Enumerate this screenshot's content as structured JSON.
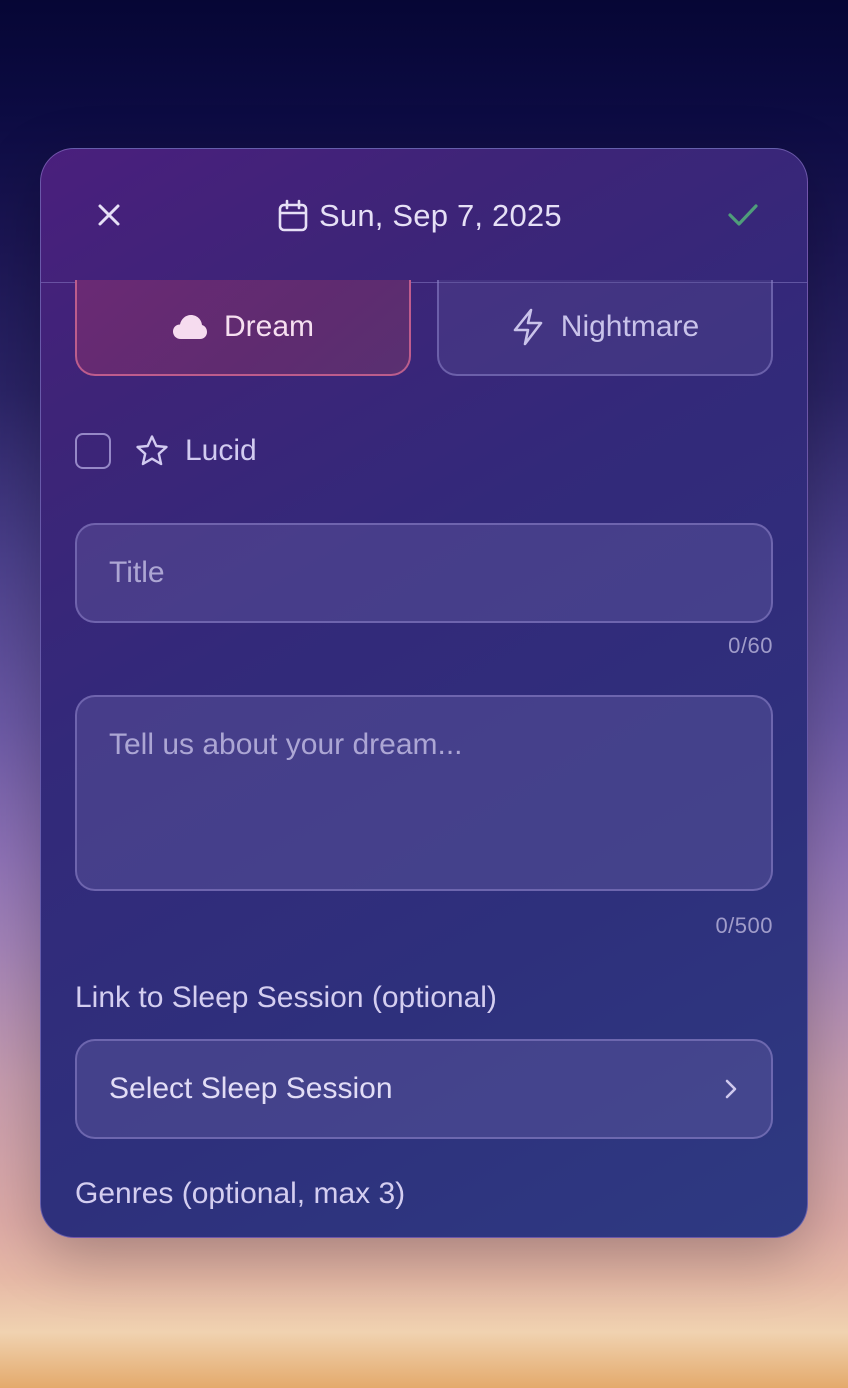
{
  "header": {
    "date": "Sun, Sep 7, 2025",
    "close_icon": "close-icon",
    "calendar_icon": "calendar-icon",
    "confirm_icon": "check-icon"
  },
  "type_toggle": {
    "dream_label": "Dream",
    "dream_icon": "cloud-icon",
    "nightmare_label": "Nightmare",
    "nightmare_icon": "lightning-icon",
    "selected": "Dream"
  },
  "lucid": {
    "label": "Lucid",
    "checked": false,
    "icon": "star-icon"
  },
  "title": {
    "placeholder": "Title",
    "value": "",
    "counter": "0/60"
  },
  "description": {
    "placeholder": "Tell us about your dream...",
    "value": "",
    "counter": "0/500"
  },
  "sleep_session": {
    "label": "Link to Sleep Session (optional)",
    "select_label": "Select Sleep Session",
    "icon": "chevron-right-icon"
  },
  "genres": {
    "label": "Genres (optional, max 3)"
  },
  "colors": {
    "accent_check": "#4f9d7a",
    "dream_border": "#dc6e96",
    "card_bg": "#33297a"
  }
}
